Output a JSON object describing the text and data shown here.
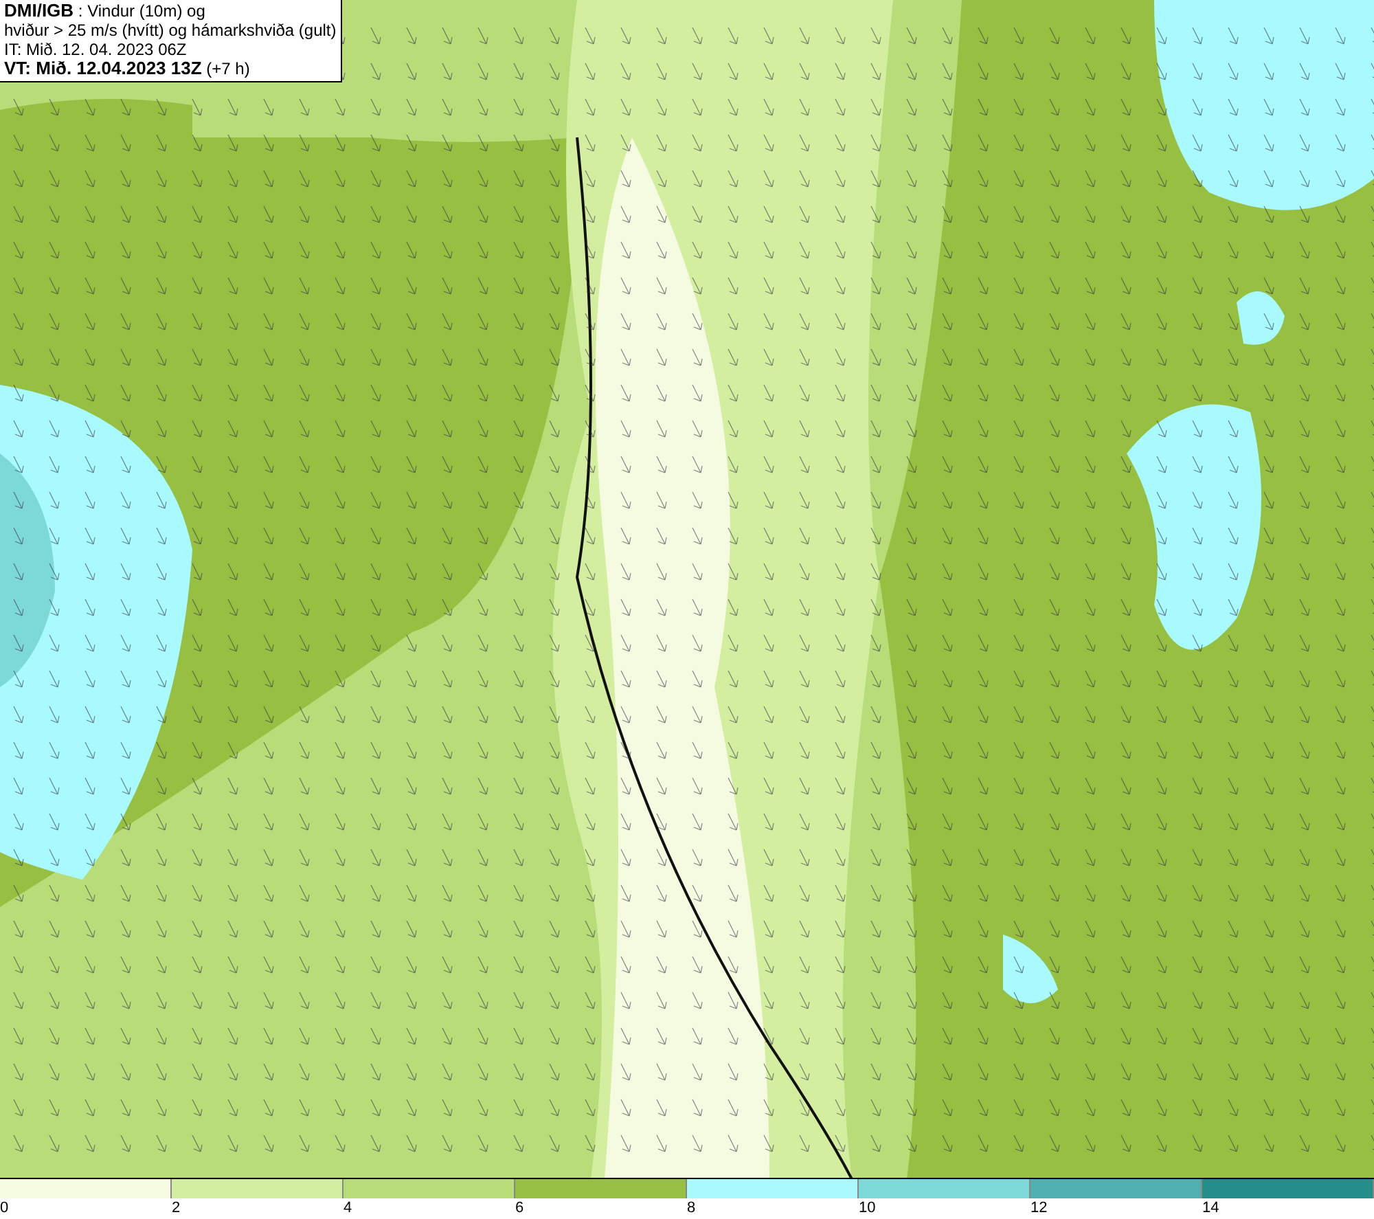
{
  "header": {
    "lines": [
      "**DMI/IGB** : Vindur (10m) og",
      "hviður > 25 m/s (hvítt) og hámarkshviða (gult)",
      "IT: Mið. 12. 04. 2023 06Z",
      "**VT: Mið. 12.04.2023 13Z** (+7 h)"
    ]
  },
  "legend": {
    "bins": [
      {
        "color": "#f5fbe0"
      },
      {
        "color": "#d4eea0"
      },
      {
        "color": "#b8dc78"
      },
      {
        "color": "#97c042"
      },
      {
        "color": "#a8faff"
      },
      {
        "color": "#7dd8d8"
      },
      {
        "color": "#50b0b0"
      },
      {
        "color": "#258e8a"
      }
    ],
    "ticks": [
      "0",
      "2",
      "4",
      "6",
      "8",
      "10",
      "12",
      "14"
    ]
  }
}
